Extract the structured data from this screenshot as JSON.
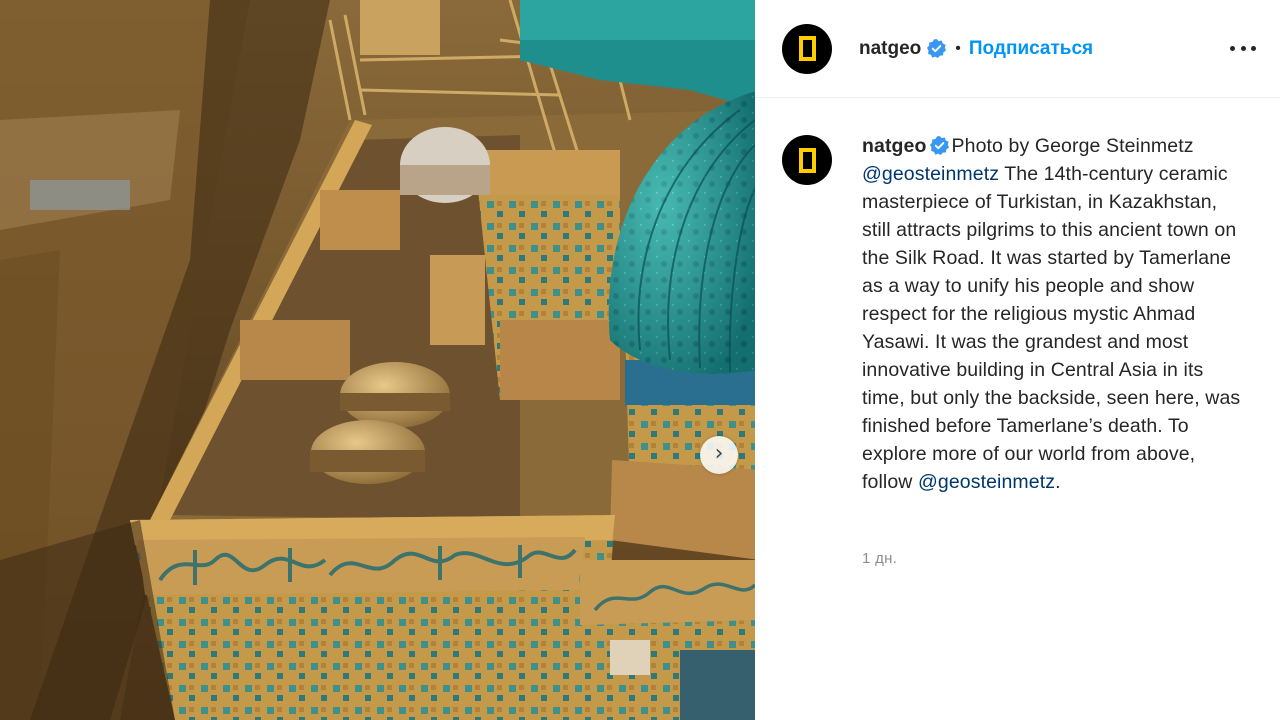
{
  "post": {
    "photo": {
      "alt": "Aerial view of the Mausoleum of Khoja Ahmed Yasawi with turquoise ribbed dome",
      "next_icon": "chevron-right-icon",
      "next_glyph": "›"
    },
    "header": {
      "username": "natgeo",
      "verified_icon": "verified-badge-icon",
      "separator": "•",
      "follow_label": "Подписаться",
      "more_icon": "more-horizontal-icon"
    },
    "caption": {
      "username": "natgeo",
      "text_1": "Photo by George Steinmetz",
      "mention_1": "@geosteinmetz",
      "text_2": "The 14th-century ceramic masterpiece of Turkistan, in Kazakhstan, still attracts pilgrims to this ancient town on the Silk Road. It was started by Tamerlane as a way to unify his people and show respect for the religious mystic Ahmad Yasawi. It was the grandest and most innovative building in Central Asia in its time, but only the backside, seen here, was finished before Tamerlane’s death. To explore more of our world from above, follow",
      "mention_2": "@geosteinmetz",
      "text_3": ".",
      "time": "1 дн."
    },
    "colors": {
      "link_blue": "#0095f6",
      "mention_blue": "#00376b",
      "natgeo_yellow": "#ffcc00",
      "verified_blue": "#3897f0",
      "muted_gray": "#8e8e8e"
    }
  }
}
